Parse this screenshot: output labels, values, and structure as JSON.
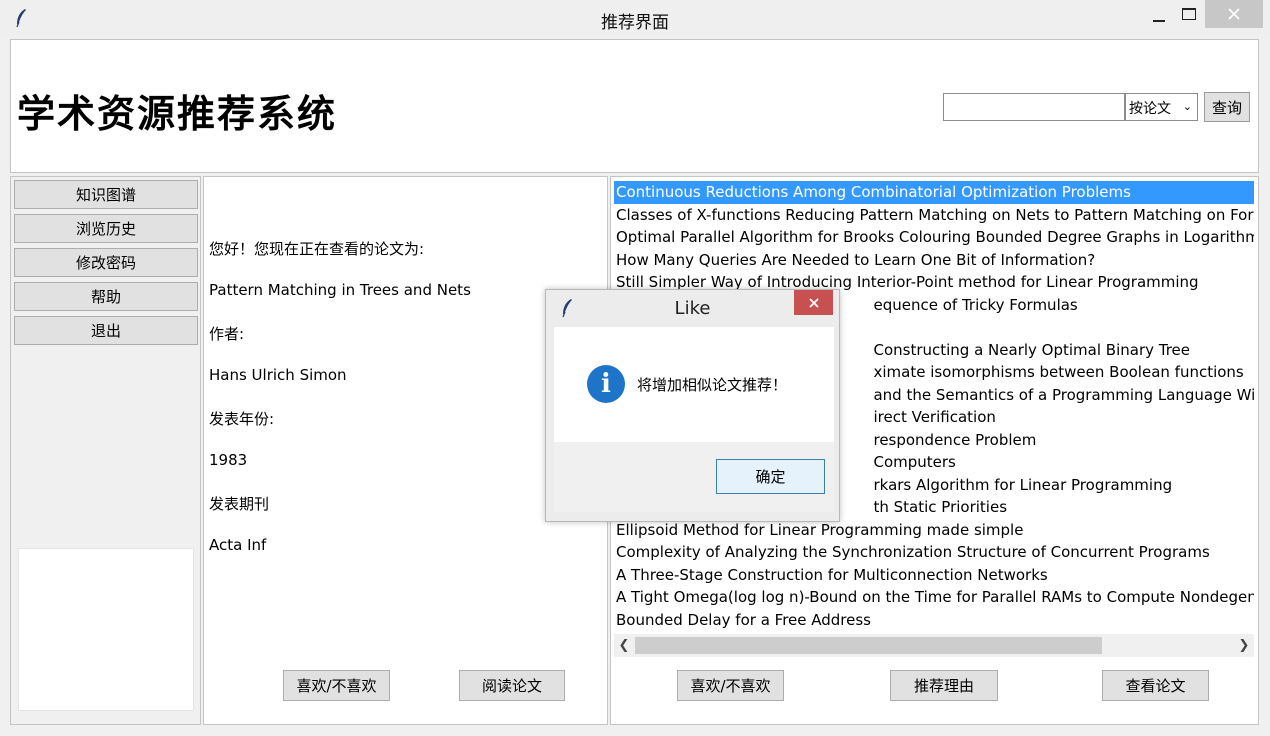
{
  "window": {
    "title": "推荐界面"
  },
  "header": {
    "app_title": "学术资源推荐系统",
    "search_value": "",
    "search_mode": "按论文",
    "search_button": "查询"
  },
  "sidebar": {
    "items": [
      {
        "label": "知识图谱"
      },
      {
        "label": "浏览历史"
      },
      {
        "label": "修改密码"
      },
      {
        "label": "帮助"
      },
      {
        "label": "退出"
      }
    ]
  },
  "details": {
    "greeting": "您好！您现在正在查看的论文为:",
    "paper_title": "Pattern Matching in Trees and Nets",
    "author_label": "作者:",
    "author": "Hans Ulrich Simon",
    "year_label": "发表年份:",
    "year": "1983",
    "journal_label": "发表期刊",
    "journal": "Acta Inf",
    "like_button": "喜欢/不喜欢",
    "read_button": "阅读论文"
  },
  "recommendations": {
    "items": [
      "Continuous Reductions Among Combinatorial Optimization Problems",
      "Classes of X-functions Reducing Pattern Matching on Nets to Pattern Matching on Fores",
      "Optimal Parallel Algorithm for Brooks Colouring Bounded Degree Graphs in Logarithmi",
      "How Many Queries Are Needed to Learn One Bit of Information?",
      "Still Simpler Way of Introducing Interior-Point method for Linear Programming",
      "                                                      equence of Tricky Formulas",
      "",
      "                                                      Constructing a Nearly Optimal Binary Tree",
      "                                                      ximate isomorphisms between Boolean functions",
      "                                                      and the Semantics of a Programming Language With Go",
      "                                                      irect Verification",
      "                                                      respondence Problem",
      "                                                      Computers",
      "                                                      rkars Algorithm for Linear Programming",
      "                                                      th Static Priorities",
      "Ellipsoid Method for Linear Programming made simple",
      "Complexity of Analyzing the Synchronization Structure of Concurrent Programs",
      "A Three-Stage Construction for Multiconnection Networks",
      "A Tight Omega(log log n)-Bound on the Time for Parallel RAMs to Compute Nondegen",
      "Bounded Delay for a Free Address"
    ],
    "selected_index": 0,
    "like_button": "喜欢/不喜欢",
    "reason_button": "推荐理由",
    "view_button": "查看论文"
  },
  "dialog": {
    "title": "Like",
    "message": "将增加相似论文推荐！",
    "ok_button": "确定",
    "icon": "info-icon"
  },
  "colors": {
    "selection": "#3399ff",
    "info_icon": "#1e74c8",
    "close_button": "#c75050"
  }
}
